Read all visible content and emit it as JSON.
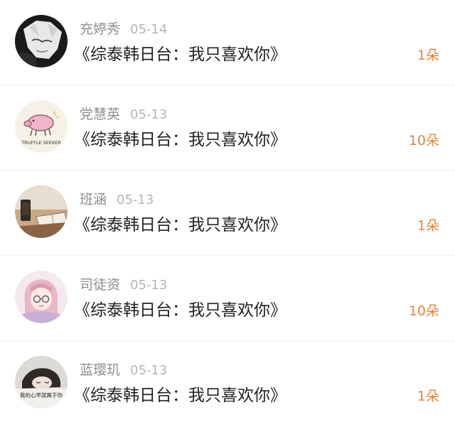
{
  "accent_color": "#e5843a",
  "rows": [
    {
      "avatar_icon": "anime-avatar",
      "name": "充婷秀",
      "date": "05-14",
      "title": "《综泰韩日台：我只喜欢你》",
      "amount": "1朵"
    },
    {
      "avatar_icon": "truffle-pig-avatar",
      "name": "党慧英",
      "date": "05-13",
      "title": "《综泰韩日台：我只喜欢你》",
      "amount": "10朵",
      "avatar_text": "TRUFFLE SEEKER"
    },
    {
      "avatar_icon": "coffee-book-avatar",
      "name": "班涵",
      "date": "05-13",
      "title": "《综泰韩日台：我只喜欢你》",
      "amount": "1朵"
    },
    {
      "avatar_icon": "anime-girl-avatar",
      "name": "司徒资",
      "date": "05-13",
      "title": "《综泰韩日台：我只喜欢你》",
      "amount": "10朵"
    },
    {
      "avatar_icon": "sleeping-girl-avatar",
      "name": "蓝璎玑",
      "date": "05-13",
      "title": "《综泰韩日台：我只喜欢你》",
      "amount": "1朵",
      "avatar_text": "我的心早就属于你"
    }
  ]
}
